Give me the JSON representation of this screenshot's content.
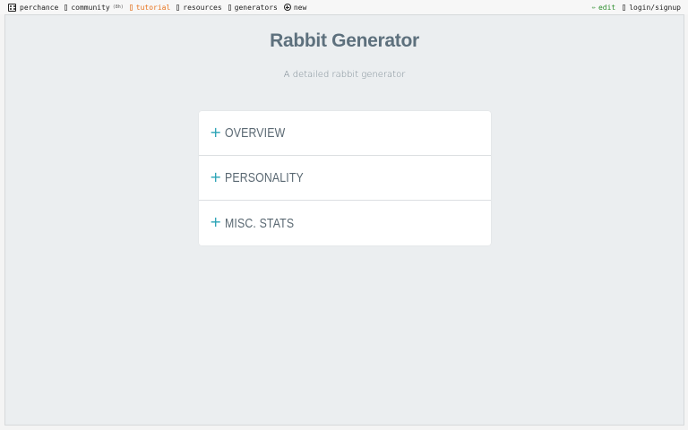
{
  "nav": {
    "left": [
      {
        "label": "perchance",
        "icon": "dice-icon"
      },
      {
        "label": "community",
        "count": "(8h)",
        "icon": "box-icon"
      },
      {
        "label": "tutorial",
        "icon": "box-icon",
        "color": "#e8731d"
      },
      {
        "label": "resources",
        "icon": "box-icon"
      },
      {
        "label": "generators",
        "icon": "box-icon"
      },
      {
        "label": "new",
        "icon": "plus-circle-icon"
      }
    ],
    "right": [
      {
        "label": "edit",
        "icon": "pencil-icon",
        "color": "#2f8f2f"
      },
      {
        "label": "login/signup",
        "icon": "box-icon"
      }
    ]
  },
  "page": {
    "title": "Rabbit Generator",
    "subtitle": "A detailed rabbit generator"
  },
  "accordion": {
    "items": [
      {
        "label": "OVERVIEW",
        "icon": "plus-icon"
      },
      {
        "label": "PERSONALITY",
        "icon": "plus-icon"
      },
      {
        "label": "MISC. STATS",
        "icon": "plus-icon"
      }
    ]
  },
  "colors": {
    "title": "#5d707d",
    "accent": "#2aa3b5",
    "background": "#ebeef0"
  }
}
